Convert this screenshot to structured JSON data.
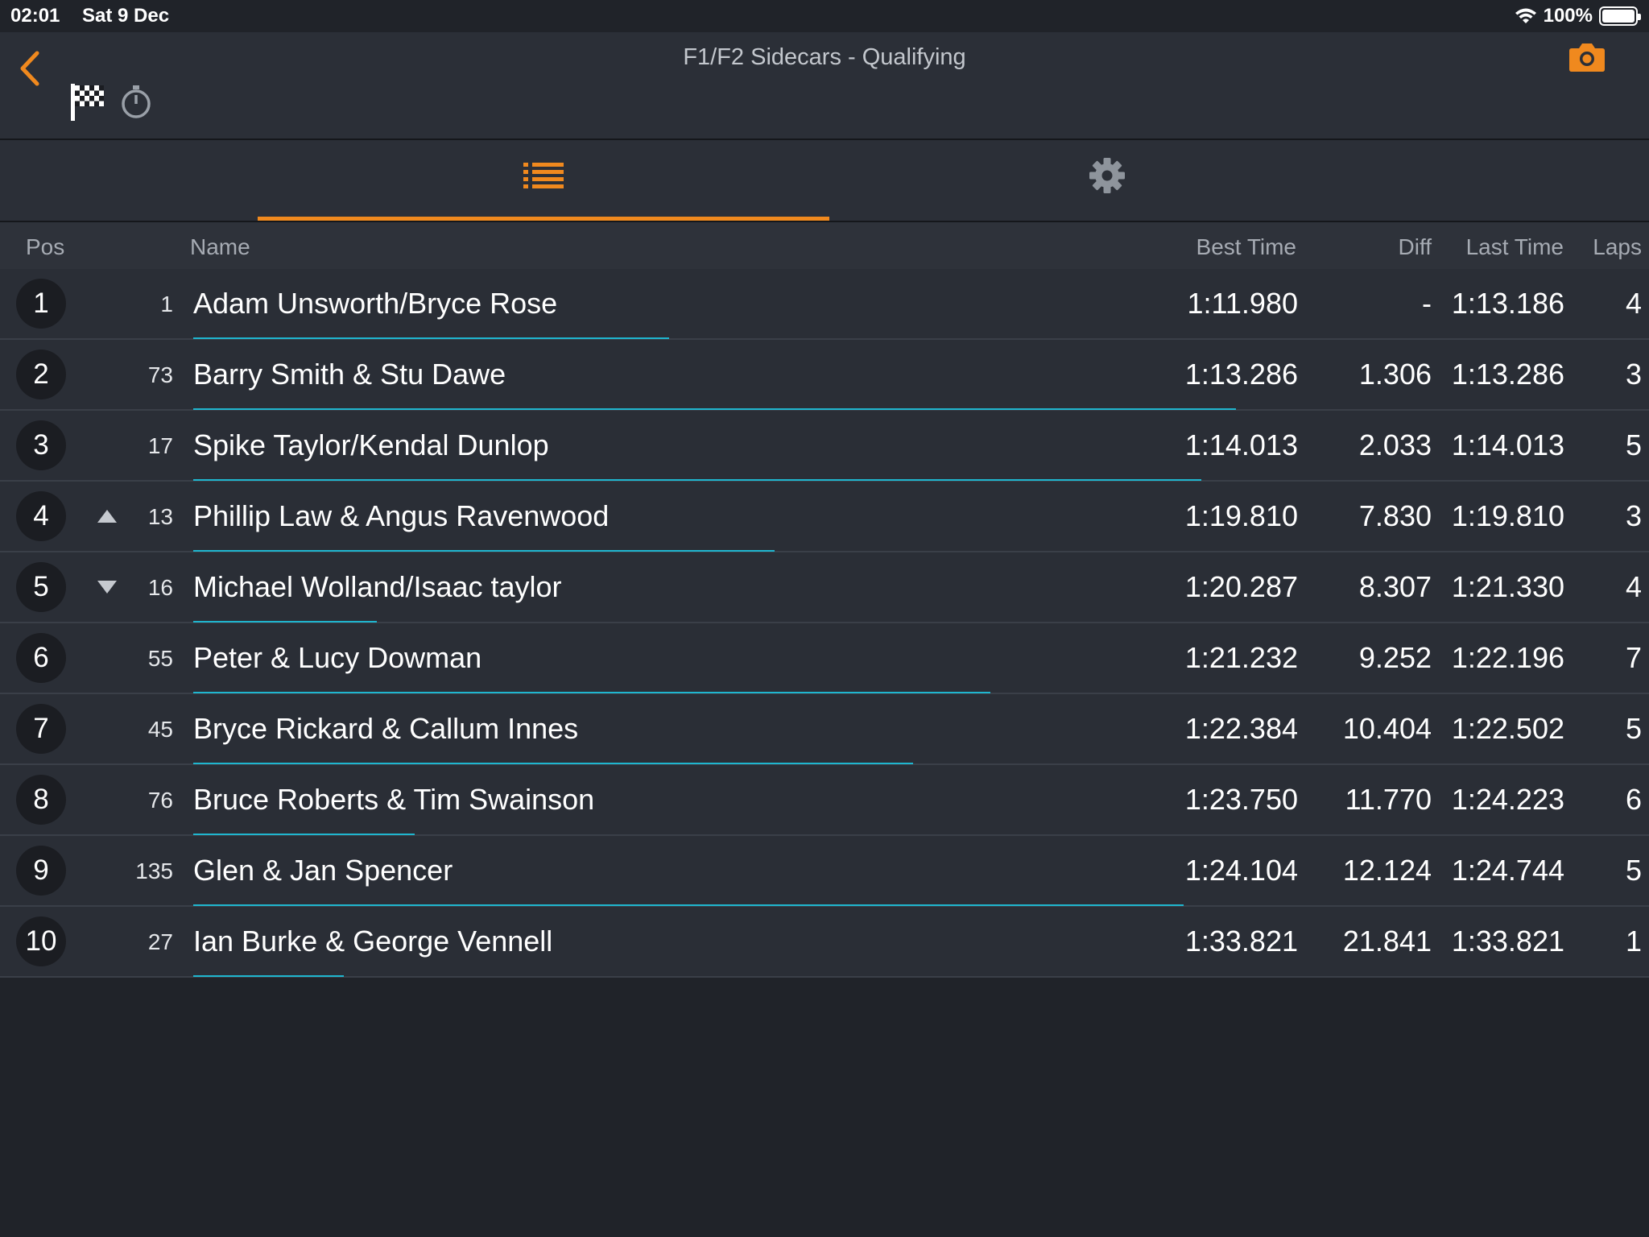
{
  "status_bar": {
    "time": "02:01",
    "date": "Sat 9 Dec",
    "battery": "100%"
  },
  "nav": {
    "title": "F1/F2 Sidecars - Qualifying"
  },
  "colors": {
    "accent": "#f0891e",
    "progress": "#1fb6cf",
    "background": "#202329"
  },
  "table": {
    "headers": {
      "pos": "Pos",
      "name": "Name",
      "best": "Best Time",
      "diff": "Diff",
      "last": "Last Time",
      "laps": "Laps"
    },
    "rows": [
      {
        "pos": "1",
        "trend": "",
        "num": "1",
        "name": "Adam Unsworth/Bryce Rose",
        "best": "1:11.980",
        "diff": "-",
        "last": "1:13.186",
        "laps": "4",
        "progress": 0.329
      },
      {
        "pos": "2",
        "trend": "",
        "num": "73",
        "name": "Barry Smith & Stu Dawe",
        "best": "1:13.286",
        "diff": "1.306",
        "last": "1:13.286",
        "laps": "3",
        "progress": 0.721
      },
      {
        "pos": "3",
        "trend": "",
        "num": "17",
        "name": "Spike Taylor/Kendal Dunlop",
        "best": "1:14.013",
        "diff": "2.033",
        "last": "1:14.013",
        "laps": "5",
        "progress": 0.697
      },
      {
        "pos": "4",
        "trend": "up",
        "num": "13",
        "name": "Phillip Law & Angus Ravenwood",
        "best": "1:19.810",
        "diff": "7.830",
        "last": "1:19.810",
        "laps": "3",
        "progress": 0.402
      },
      {
        "pos": "5",
        "trend": "down",
        "num": "16",
        "name": "Michael Wolland/Isaac taylor",
        "best": "1:20.287",
        "diff": "8.307",
        "last": "1:21.330",
        "laps": "4",
        "progress": 0.127
      },
      {
        "pos": "6",
        "trend": "",
        "num": "55",
        "name": "Peter & Lucy Dowman",
        "best": "1:21.232",
        "diff": "9.252",
        "last": "1:22.196",
        "laps": "7",
        "progress": 0.551
      },
      {
        "pos": "7",
        "trend": "",
        "num": "45",
        "name": "Bryce Rickard & Callum Innes",
        "best": "1:22.384",
        "diff": "10.404",
        "last": "1:22.502",
        "laps": "5",
        "progress": 0.498
      },
      {
        "pos": "8",
        "trend": "",
        "num": "76",
        "name": "Bruce Roberts & Tim Swainson",
        "best": "1:23.750",
        "diff": "11.770",
        "last": "1:24.223",
        "laps": "6",
        "progress": 0.153
      },
      {
        "pos": "9",
        "trend": "",
        "num": "135",
        "name": "Glen & Jan Spencer",
        "best": "1:24.104",
        "diff": "12.124",
        "last": "1:24.744",
        "laps": "5",
        "progress": 0.685
      },
      {
        "pos": "10",
        "trend": "",
        "num": "27",
        "name": "Ian Burke & George Vennell",
        "best": "1:33.821",
        "diff": "21.841",
        "last": "1:33.821",
        "laps": "1",
        "progress": 0.104
      }
    ]
  }
}
